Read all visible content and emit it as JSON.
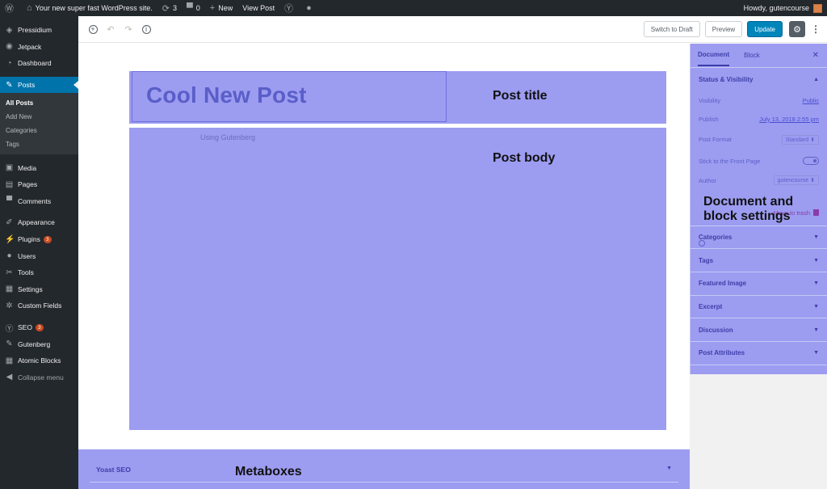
{
  "admin_bar": {
    "site_name": "Your new super fast WordPress site.",
    "updates": "3",
    "comments": "0",
    "new_label": "New",
    "view_post": "View Post",
    "greeting": "Howdy, gutencourse"
  },
  "sidebar": {
    "items": [
      {
        "label": "Pressidium",
        "icon": "pressidium-icon"
      },
      {
        "label": "Jetpack",
        "icon": "jetpack-icon"
      },
      {
        "label": "Dashboard",
        "icon": "dashboard-icon"
      },
      {
        "label": "Posts",
        "icon": "pin-icon"
      },
      {
        "label": "Media",
        "icon": "media-icon"
      },
      {
        "label": "Pages",
        "icon": "pages-icon"
      },
      {
        "label": "Comments",
        "icon": "comments-icon"
      },
      {
        "label": "Appearance",
        "icon": "brush-icon"
      },
      {
        "label": "Plugins",
        "icon": "plugin-icon",
        "badge": "3"
      },
      {
        "label": "Users",
        "icon": "users-icon"
      },
      {
        "label": "Tools",
        "icon": "wrench-icon"
      },
      {
        "label": "Settings",
        "icon": "settings-icon"
      },
      {
        "label": "Custom Fields",
        "icon": "gear-icon"
      },
      {
        "label": "SEO",
        "icon": "yoast-icon",
        "badge": "3"
      },
      {
        "label": "Gutenberg",
        "icon": "gutenberg-icon"
      },
      {
        "label": "Atomic Blocks",
        "icon": "blocks-icon"
      },
      {
        "label": "Collapse menu",
        "icon": "collapse-icon"
      }
    ],
    "posts_submenu": [
      "All Posts",
      "Add New",
      "Categories",
      "Tags"
    ]
  },
  "toolbar": {
    "switch_to_draft": "Switch to Draft",
    "preview": "Preview",
    "update": "Update"
  },
  "editor": {
    "post_title": "Cool New Post",
    "body_text": "Using Gutenberg"
  },
  "annotations": {
    "post_title": "Post title",
    "post_body": "Post body",
    "settings_line1": "Document and",
    "settings_line2": "block settings",
    "metaboxes": "Metaboxes"
  },
  "settings_panel": {
    "tab_document": "Document",
    "tab_block": "Block",
    "status_visibility": "Status & Visibility",
    "visibility_label": "Visibility",
    "visibility_value": "Public",
    "publish_label": "Publish",
    "publish_value": "July 13, 2018 2:55 pm",
    "post_format_label": "Post Format",
    "post_format_value": "Standard",
    "sticky_label": "Stick to the Front Page",
    "author_label": "Author",
    "author_value": "gutencourse",
    "move_to_trash": "Move to trash",
    "panels": [
      "Categories",
      "Tags",
      "Featured Image",
      "Excerpt",
      "Discussion",
      "Post Attributes"
    ]
  },
  "metabox": {
    "yoast_title": "Yoast SEO"
  },
  "colors": {
    "highlight": "#7676ec",
    "admin_dark": "#23282d",
    "accent": "#0073aa",
    "update_button": "#0085ba"
  }
}
